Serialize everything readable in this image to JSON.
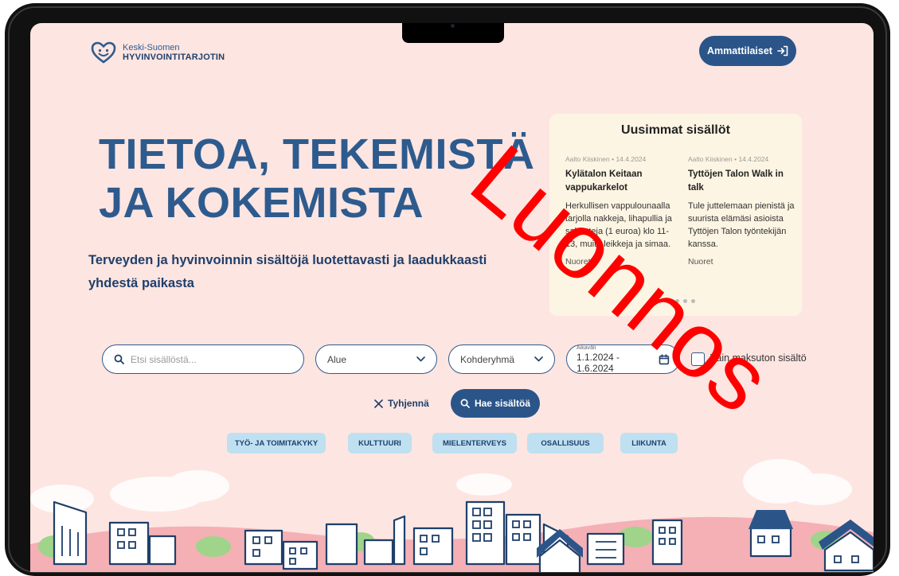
{
  "logo": {
    "line1": "Keski-Suomen",
    "line2": "HYVINVOINTITARJOTIN"
  },
  "header": {
    "pro_button": "Ammattilaiset"
  },
  "hero": {
    "title": "TIETOA, TEKEMISTÄ\nJA KOKEMISTA",
    "subtitle": "Terveyden ja hyvinvoinnin sisältöjä luotettavasti ja laadukkaasti yhdestä paikasta"
  },
  "latest": {
    "heading": "Uusimmat sisällöt",
    "cards": [
      {
        "meta": "Aalto Kiiskinen • 14.4.2024",
        "title": "Kylätalon Keitaan vappukarkelot",
        "text": "Herkullisen vappulounaalla tarjolla nakkeja, lihapullia ja salaatteja (1 euroa) klo 11-13, muita leikkeja ja simaa.",
        "tag": "Nuoret"
      },
      {
        "meta": "Aalto Kiiskinen • 14.4.2024",
        "title": "Tyttöjen Talon Walk in talk",
        "text": "Tule juttelemaan pienistä ja suurista elämäsi asioista Tyttöjen Talon työntekijän kanssa.",
        "tag": "Nuoret"
      }
    ]
  },
  "search": {
    "placeholder": "Etsi sisällöstä...",
    "area": "Alue",
    "target_group": "Kohderyhmä",
    "date_label": "Aikaväli",
    "date_value": "1.1.2024 - 1.6.2024",
    "checkbox_label": "Vain maksuton sisältö",
    "clear": "Tyhjennä",
    "submit": "Hae sisältöä"
  },
  "categories": [
    "TYÖ- JA TOIMITAKYKY",
    "KULTTUURI",
    "MIELENTERVEYS",
    "OSALLISUUS",
    "LIIKUNTA"
  ],
  "watermark": "Luonnos",
  "colors": {
    "primary": "#2b5589",
    "background": "#fde5e1",
    "category": "#bfe0f1",
    "watermark": "#ff0000"
  }
}
